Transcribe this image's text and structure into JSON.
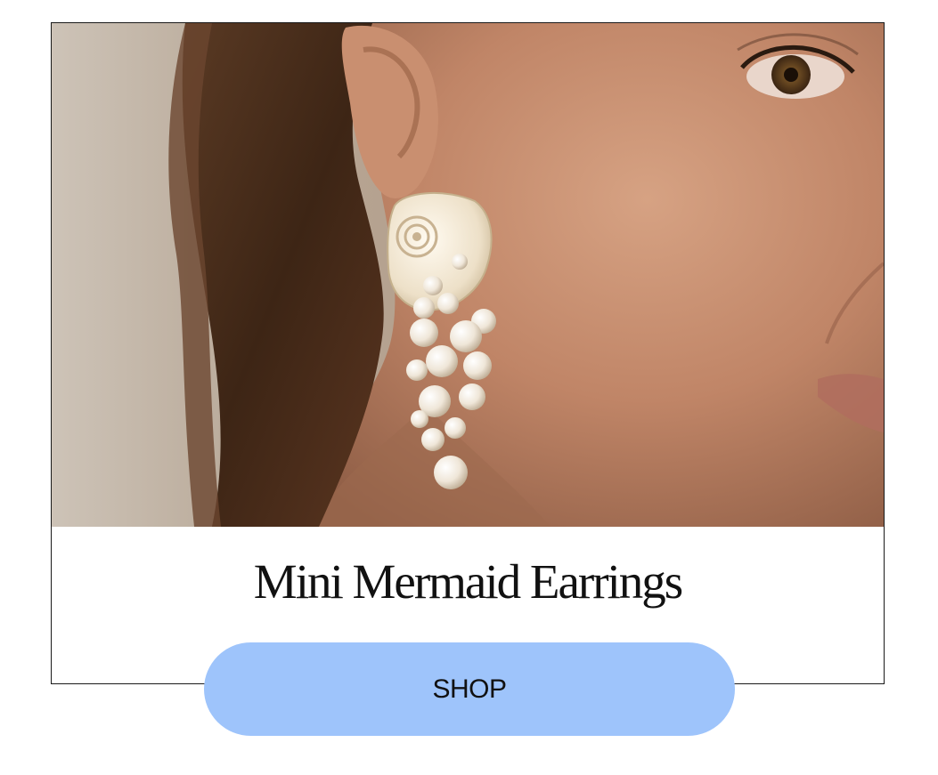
{
  "product": {
    "title": "Mini Mermaid Earrings",
    "image_icon": "earring-model-photo"
  },
  "cta": {
    "label": "SHOP",
    "background_color": "#9ec4fb"
  }
}
